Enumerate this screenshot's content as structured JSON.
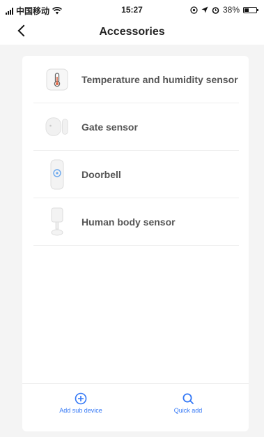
{
  "status_bar": {
    "carrier": "中国移动",
    "time": "15:27",
    "battery": "38%",
    "battery_level": 0.38
  },
  "nav": {
    "title": "Accessories"
  },
  "accessories": [
    {
      "label": "Temperature and humidity sensor",
      "icon": "thermometer-icon"
    },
    {
      "label": "Gate sensor",
      "icon": "gate-sensor-icon"
    },
    {
      "label": "Doorbell",
      "icon": "doorbell-icon"
    },
    {
      "label": "Human body sensor",
      "icon": "motion-sensor-icon"
    }
  ],
  "footer": {
    "add_sub_device": "Add sub device",
    "quick_add": "Quick add"
  },
  "colors": {
    "accent": "#3478f6",
    "background": "#f4f4f4",
    "card": "#ffffff"
  }
}
